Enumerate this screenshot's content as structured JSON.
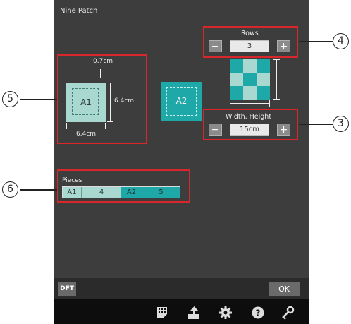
{
  "window_title": "Nine Patch",
  "rows": {
    "label": "Rows",
    "value": "3",
    "minus": "−",
    "plus": "+"
  },
  "size": {
    "label": "Width, Height",
    "value": "15cm",
    "minus": "−",
    "plus": "+"
  },
  "piece_a1": {
    "label": "A1",
    "seam": "0.7cm",
    "height": "6.4cm",
    "width": "6.4cm"
  },
  "piece_a2": {
    "label": "A2"
  },
  "pieces": {
    "label": "Pieces",
    "items": [
      {
        "name": "A1",
        "count": "4"
      },
      {
        "name": "A2",
        "count": "5"
      }
    ]
  },
  "callouts": {
    "c3": "3",
    "c4": "4",
    "c5": "5",
    "c6": "6"
  },
  "buttons": {
    "dft": "DFT",
    "ok": "OK"
  },
  "colors": {
    "light_teal": "#a8d8cf",
    "dark_teal": "#1ea8a8",
    "callout_red": "#d9262b"
  },
  "grid_pattern": [
    [
      "A2",
      "A1",
      "A2"
    ],
    [
      "A1",
      "A2",
      "A1"
    ],
    [
      "A2",
      "A1",
      "A2"
    ]
  ],
  "toolbar_icons": [
    "stitch-pattern-icon",
    "export-icon",
    "settings-gear-icon",
    "help-icon",
    "key-icon"
  ]
}
